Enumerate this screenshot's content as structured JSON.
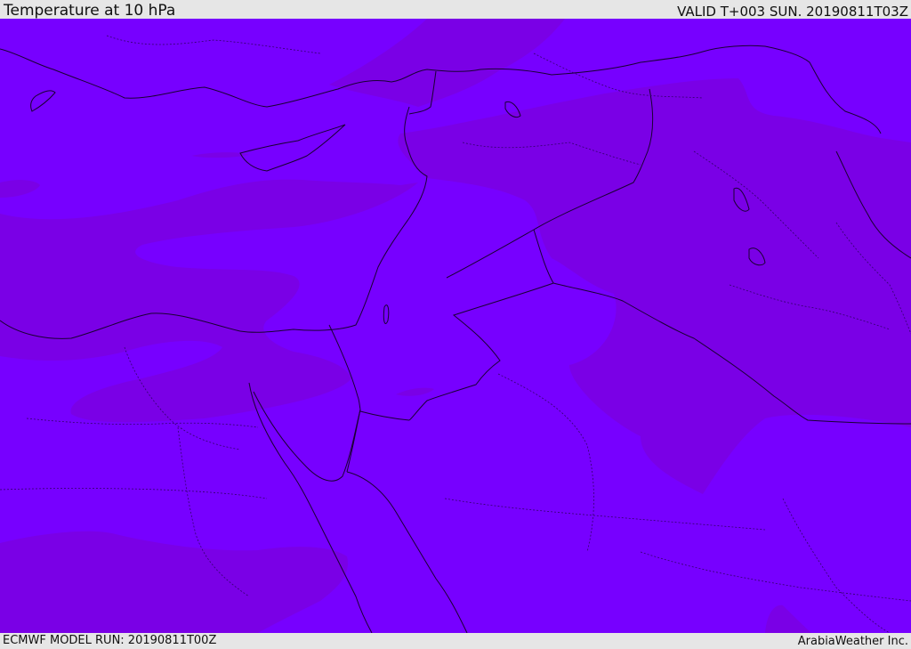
{
  "header": {
    "title": "Temperature at 10 hPa",
    "valid": "VALID T+003 SUN. 20190811T03Z"
  },
  "footer": {
    "model_run": "ECMWF MODEL RUN: 20190811T00Z",
    "credit": "ArabiaWeather Inc."
  },
  "map": {
    "region": "Eastern Mediterranean and Middle East",
    "base_color": "#7700ff",
    "band_color": "#7a00e6",
    "coast_color": "#1a0033",
    "border_color": "#1a0033"
  }
}
